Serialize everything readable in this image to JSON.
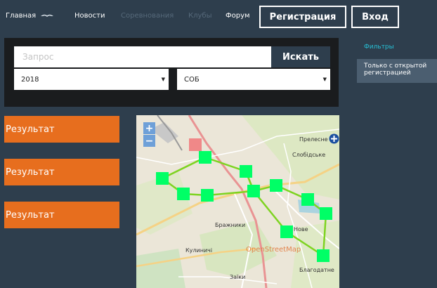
{
  "nav": {
    "items": [
      {
        "label": "Главная",
        "dim": false
      },
      {
        "label": "Новости",
        "dim": false
      },
      {
        "label": "Соревнования",
        "dim": true
      },
      {
        "label": "Клубы",
        "dim": true
      },
      {
        "label": "Форум",
        "dim": false
      }
    ],
    "register_label": "Регистрация",
    "login_label": "Вход"
  },
  "search": {
    "placeholder": "Запрос",
    "value": "",
    "button_label": "Искать",
    "year_select": "2018",
    "type_select": "СОБ"
  },
  "filters": {
    "title": "Фильтры",
    "item_label": "Только с открытой регистрацией"
  },
  "results": [
    {
      "label": "Результат"
    },
    {
      "label": "Результат"
    },
    {
      "label": "Результат"
    }
  ],
  "map": {
    "zoom_in": "+",
    "zoom_out": "−",
    "attribution": "OpenStreetMap",
    "places": [
      "Прелесне",
      "Слобідське",
      "Бражники",
      "Кулиничі",
      "Благодатне",
      "Заїки",
      "Нове"
    ],
    "colors": {
      "route": "#7ed321",
      "node": "#00ff66",
      "start_node": "#f08888"
    }
  },
  "colors": {
    "background": "#2e3e4d",
    "accent": "#e76e1e",
    "filter_accent": "#27c0d6"
  }
}
